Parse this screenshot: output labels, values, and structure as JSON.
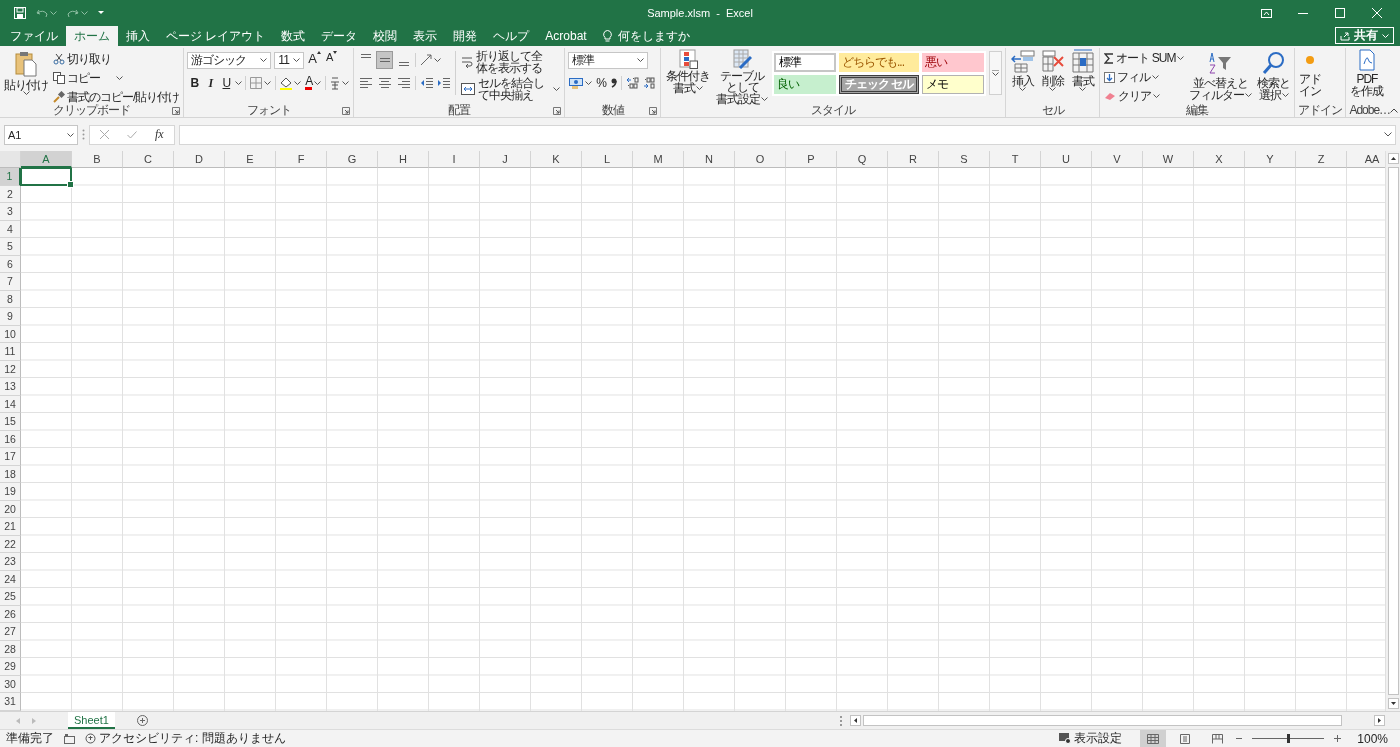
{
  "window": {
    "title": "Sample.xlsm  -  Excel",
    "share": "共有"
  },
  "tabs": [
    {
      "label": "ファイル",
      "selected": false
    },
    {
      "label": "ホーム",
      "selected": true
    },
    {
      "label": "挿入",
      "selected": false
    },
    {
      "label": "ページ レイアウト",
      "selected": false
    },
    {
      "label": "数式",
      "selected": false
    },
    {
      "label": "データ",
      "selected": false
    },
    {
      "label": "校閲",
      "selected": false
    },
    {
      "label": "表示",
      "selected": false
    },
    {
      "label": "開発",
      "selected": false
    },
    {
      "label": "ヘルプ",
      "selected": false
    },
    {
      "label": "Acrobat",
      "selected": false
    }
  ],
  "tell_me": "何をしますか",
  "ribbon": {
    "clipboard": {
      "label": "クリップボード",
      "paste": "貼り付け",
      "cut": "切り取り",
      "copy": "コピー",
      "format_painter": "書式のコピー/貼り付け"
    },
    "font": {
      "label": "フォント",
      "font_name": "游ゴシック",
      "font_size": "11",
      "size_buttons": [
        {
          "kind": "grow",
          "label": "A"
        },
        {
          "kind": "shrink",
          "label": "A"
        }
      ],
      "style_buttons": [
        {
          "kind": "bold",
          "label": "B"
        },
        {
          "kind": "italic",
          "label": "I"
        },
        {
          "kind": "underline",
          "label": "U"
        }
      ],
      "font_color": "A"
    },
    "alignment": {
      "label": "配置",
      "vertical": [
        {
          "kind": "top",
          "selected": false
        },
        {
          "kind": "middle",
          "selected": true
        },
        {
          "kind": "bottom",
          "selected": false
        }
      ],
      "wrap_text": "折り返して全体を表示する",
      "merge": "セルを結合して中央揃え"
    },
    "number": {
      "label": "数値",
      "format": "標準",
      "percent": "%"
    },
    "styles": {
      "label": "スタイル",
      "conditional_formatting": [
        "条件付き",
        "書式"
      ],
      "format_as_table": [
        "テーブルとして",
        "書式設定"
      ],
      "cell_styles": [
        {
          "label": "標準",
          "kind": "normal",
          "color": "#ffffff"
        },
        {
          "label": "どちらでも...",
          "kind": "neutral",
          "color": "#ffeb9c"
        },
        {
          "label": "悪い",
          "kind": "bad",
          "color": "#ffc7ce"
        },
        {
          "label": "良い",
          "kind": "good",
          "color": "#c6efce"
        },
        {
          "label": "チェック セル",
          "kind": "check",
          "color": "#a5a5a5"
        },
        {
          "label": "メモ",
          "kind": "note",
          "color": "#ffffcc"
        }
      ]
    },
    "cells": {
      "label": "セル",
      "buttons": [
        {
          "kind": "insert",
          "label": "挿入"
        },
        {
          "kind": "delete",
          "label": "削除"
        },
        {
          "kind": "format",
          "label": "書式"
        }
      ]
    },
    "editing": {
      "label": "編集",
      "autosum": "オート SUM",
      "fill": "フィル",
      "clear": "クリア",
      "sort_filter": [
        "並べ替えと",
        "フィルター"
      ],
      "find_select": [
        "検索と",
        "選択"
      ]
    },
    "addins": {
      "label": "アドイン",
      "button": [
        "アド",
        "イン"
      ]
    },
    "adobe": {
      "label": "Adobe…",
      "button": [
        "PDF",
        "を作成"
      ]
    }
  },
  "formula_bar": {
    "name_box": "A1",
    "function_label": "fx"
  },
  "sheet": {
    "columns": [
      {
        "label": "A",
        "selected": true
      },
      {
        "label": "B",
        "selected": false
      },
      {
        "label": "C",
        "selected": false
      },
      {
        "label": "D",
        "selected": false
      },
      {
        "label": "E",
        "selected": false
      },
      {
        "label": "F",
        "selected": false
      },
      {
        "label": "G",
        "selected": false
      },
      {
        "label": "H",
        "selected": false
      },
      {
        "label": "I",
        "selected": false
      },
      {
        "label": "J",
        "selected": false
      },
      {
        "label": "K",
        "selected": false
      },
      {
        "label": "L",
        "selected": false
      },
      {
        "label": "M",
        "selected": false
      },
      {
        "label": "N",
        "selected": false
      },
      {
        "label": "O",
        "selected": false
      },
      {
        "label": "P",
        "selected": false
      },
      {
        "label": "Q",
        "selected": false
      },
      {
        "label": "R",
        "selected": false
      },
      {
        "label": "S",
        "selected": false
      },
      {
        "label": "T",
        "selected": false
      },
      {
        "label": "U",
        "selected": false
      },
      {
        "label": "V",
        "selected": false
      },
      {
        "label": "W",
        "selected": false
      },
      {
        "label": "X",
        "selected": false
      },
      {
        "label": "Y",
        "selected": false
      },
      {
        "label": "Z",
        "selected": false
      },
      {
        "label": "AA",
        "selected": false
      }
    ],
    "rows": [
      {
        "label": "1",
        "selected": true
      },
      {
        "label": "2",
        "selected": false
      },
      {
        "label": "3",
        "selected": false
      },
      {
        "label": "4",
        "selected": false
      },
      {
        "label": "5",
        "selected": false
      },
      {
        "label": "6",
        "selected": false
      },
      {
        "label": "7",
        "selected": false
      },
      {
        "label": "8",
        "selected": false
      },
      {
        "label": "9",
        "selected": false
      },
      {
        "label": "10",
        "selected": false
      },
      {
        "label": "11",
        "selected": false
      },
      {
        "label": "12",
        "selected": false
      },
      {
        "label": "13",
        "selected": false
      },
      {
        "label": "14",
        "selected": false
      },
      {
        "label": "15",
        "selected": false
      },
      {
        "label": "16",
        "selected": false
      },
      {
        "label": "17",
        "selected": false
      },
      {
        "label": "18",
        "selected": false
      },
      {
        "label": "19",
        "selected": false
      },
      {
        "label": "20",
        "selected": false
      },
      {
        "label": "21",
        "selected": false
      },
      {
        "label": "22",
        "selected": false
      },
      {
        "label": "23",
        "selected": false
      },
      {
        "label": "24",
        "selected": false
      },
      {
        "label": "25",
        "selected": false
      },
      {
        "label": "26",
        "selected": false
      },
      {
        "label": "27",
        "selected": false
      },
      {
        "label": "28",
        "selected": false
      },
      {
        "label": "29",
        "selected": false
      },
      {
        "label": "30",
        "selected": false
      },
      {
        "label": "31",
        "selected": false
      }
    ]
  },
  "sheet_tabs": [
    {
      "label": "Sheet1",
      "selected": true
    }
  ],
  "status_bar": {
    "ready": "準備完了",
    "accessibility": "アクセシビリティ: 問題ありません",
    "display_settings": "表示設定",
    "views": [
      {
        "kind": "normal",
        "selected": true
      },
      {
        "kind": "page_layout",
        "selected": false
      },
      {
        "kind": "page_break",
        "selected": false
      }
    ],
    "zoom": {
      "level": 0.5,
      "reading": "100%"
    }
  }
}
